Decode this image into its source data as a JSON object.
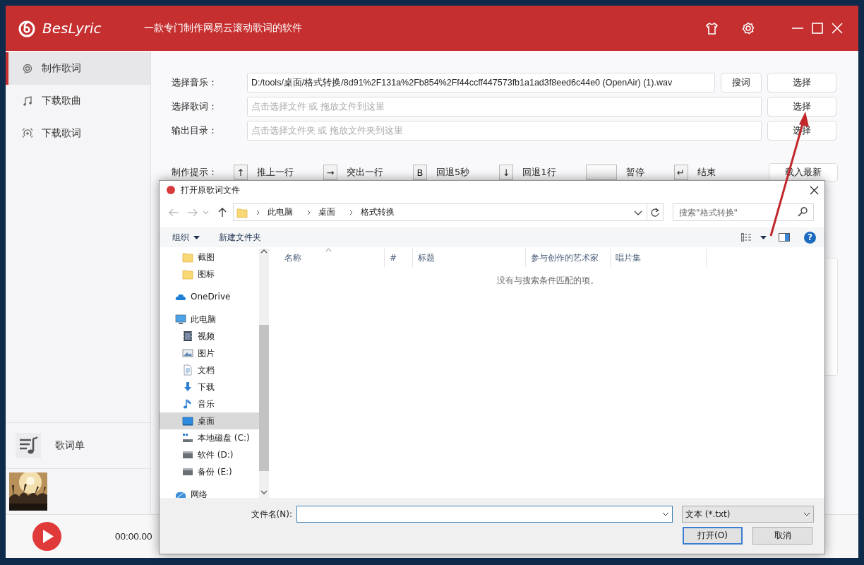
{
  "app": {
    "name": "BesLyric",
    "tagline": "一款专门制作网易云滚动歌词的软件"
  },
  "sidebar": {
    "items": [
      {
        "label": "制作歌词",
        "selected": true
      },
      {
        "label": "下载歌曲",
        "selected": false
      },
      {
        "label": "下载歌词",
        "selected": false
      }
    ],
    "playlist": "歌词单"
  },
  "player": {
    "time": "00:00.00"
  },
  "form": {
    "rows": [
      {
        "label": "选择音乐：",
        "value": "D:/tools/桌面/格式转换/8d91%2F131a%2Fb854%2Ff44ccff447573fb1a1ad3f8eed6c44e0 (OpenAir) (1).wav",
        "buttons": [
          "搜词",
          "选择"
        ]
      },
      {
        "label": "选择歌词：",
        "placeholder": "点击选择文件 或 拖放文件到这里",
        "buttons": [
          "选择"
        ]
      },
      {
        "label": "输出目录：",
        "placeholder": "点击选择文件夹 或 拖放文件夹到这里",
        "buttons": [
          "选择"
        ]
      }
    ]
  },
  "hints": {
    "label": "制作提示：",
    "items": [
      {
        "key": "↑",
        "text": "推上一行"
      },
      {
        "key": "→",
        "text": "突出一行"
      },
      {
        "key": "B",
        "text": "回退5秒"
      },
      {
        "key": "↓",
        "text": "回退1行"
      },
      {
        "text": "暂停"
      },
      {
        "key": "↵",
        "text": "结束"
      }
    ],
    "button": "载入最新"
  },
  "dialog": {
    "title": "打开原歌词文件",
    "path": [
      "此电脑",
      "桌面",
      "格式转换"
    ],
    "search_placeholder": "搜索\"格式转换\"",
    "toolbar": {
      "organize": "组织",
      "new_folder": "新建文件夹",
      "help": "?"
    },
    "nav": [
      {
        "children": [
          {
            "label": "截图",
            "kind": "folder",
            "selected": false
          },
          {
            "label": "图标",
            "kind": "folder",
            "selected": false
          }
        ]
      },
      {
        "label": "OneDrive",
        "kind": "cloud",
        "selected": false
      },
      {
        "label": "此电脑",
        "kind": "computer",
        "selected": false,
        "children": [
          {
            "label": "视频",
            "kind": "video",
            "selected": false
          },
          {
            "label": "图片",
            "kind": "pictures",
            "selected": false
          },
          {
            "label": "文档",
            "kind": "documents",
            "selected": false
          },
          {
            "label": "下载",
            "kind": "downloads",
            "selected": false
          },
          {
            "label": "音乐",
            "kind": "music",
            "selected": false
          },
          {
            "label": "桌面",
            "kind": "desktop",
            "selected": true
          },
          {
            "label": "本地磁盘 (C:)",
            "kind": "system-drive",
            "selected": false
          },
          {
            "label": "软件 (D:)",
            "kind": "drive",
            "selected": false
          },
          {
            "label": "备份 (E:)",
            "kind": "drive",
            "selected": false
          }
        ]
      },
      {
        "label": "网络",
        "kind": "network",
        "selected": false
      }
    ],
    "columns": [
      {
        "label": "名称",
        "sorted": true
      },
      {
        "label": "#",
        "sorted": false
      },
      {
        "label": "标题",
        "sorted": false
      },
      {
        "label": "参与创作的艺术家",
        "sorted": false
      },
      {
        "label": "唱片集",
        "sorted": false
      }
    ],
    "empty_message": "没有与搜索条件匹配的项。",
    "filename_label": "文件名(N):",
    "file_type": "文本 (*.txt)",
    "buttons": [
      {
        "label": "打开(O)",
        "default": true
      },
      {
        "label": "取消",
        "default": false
      }
    ]
  }
}
